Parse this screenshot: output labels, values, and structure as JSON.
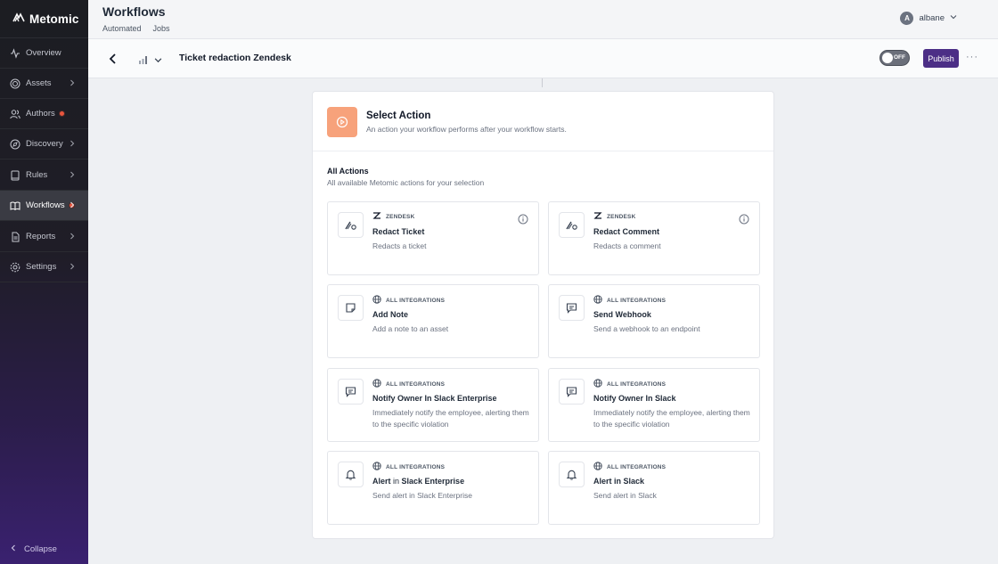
{
  "app": {
    "brand": "Metomic"
  },
  "sidebar": {
    "items": [
      {
        "label": "Overview",
        "icon": "activity-icon",
        "chevron": false,
        "badge": false
      },
      {
        "label": "Assets",
        "icon": "target-icon",
        "chevron": true,
        "badge": false
      },
      {
        "label": "Authors",
        "icon": "users-icon",
        "chevron": false,
        "badge": true
      },
      {
        "label": "Discovery",
        "icon": "compass-icon",
        "chevron": true,
        "badge": false
      },
      {
        "label": "Rules",
        "icon": "book-icon",
        "chevron": true,
        "badge": false
      },
      {
        "label": "Workflows",
        "icon": "open-book-icon",
        "chevron": true,
        "badge": true,
        "active": true
      },
      {
        "label": "Reports",
        "icon": "file-icon",
        "chevron": true,
        "badge": false
      },
      {
        "label": "Settings",
        "icon": "gear-icon",
        "chevron": true,
        "badge": false
      }
    ],
    "collapse_label": "Collapse"
  },
  "header": {
    "title": "Workflows",
    "tabs": [
      "Automated",
      "Jobs"
    ],
    "user": {
      "initial": "A",
      "name": "albane"
    }
  },
  "toolbar": {
    "workflow_title": "Ticket redaction Zendesk",
    "toggle_label": "OFF",
    "publish_label": "Publish",
    "more_label": "···"
  },
  "panel": {
    "title": "Select Action",
    "subtitle": "An action your workflow performs after your workflow starts.",
    "section_title": "All Actions",
    "section_subtitle": "All available Metomic actions for your selection",
    "cards": [
      {
        "integration": "ZENDESK",
        "title": "Redact Ticket",
        "desc": "Redacts a ticket",
        "icon": "redact-icon",
        "integ_icon": "zendesk-icon",
        "info": true
      },
      {
        "integration": "ZENDESK",
        "title": "Redact Comment",
        "desc": "Redacts a comment",
        "icon": "redact-icon",
        "integ_icon": "zendesk-icon",
        "info": true
      },
      {
        "integration": "ALL INTEGRATIONS",
        "title": "Add Note",
        "desc": "Add a note to an asset",
        "icon": "note-icon",
        "integ_icon": "globe-icon",
        "info": false
      },
      {
        "integration": "ALL INTEGRATIONS",
        "title": "Send Webhook",
        "desc": "Send a webhook to an endpoint",
        "icon": "message-icon",
        "integ_icon": "globe-icon",
        "info": false
      },
      {
        "integration": "ALL INTEGRATIONS",
        "title": "Notify Owner In Slack Enterprise",
        "desc": "Immediately notify the employee, alerting them to the specific violation",
        "icon": "message-icon",
        "integ_icon": "globe-icon",
        "info": false
      },
      {
        "integration": "ALL INTEGRATIONS",
        "title": "Notify Owner In Slack",
        "desc": "Immediately notify the employee, alerting them to the specific violation",
        "icon": "message-icon",
        "integ_icon": "globe-icon",
        "info": false
      },
      {
        "integration": "ALL INTEGRATIONS",
        "title_parts": [
          "Alert ",
          "in",
          " Slack Enterprise"
        ],
        "title": "Alert in Slack Enterprise",
        "desc": "Send alert in Slack Enterprise",
        "icon": "bell-icon",
        "integ_icon": "globe-icon",
        "info": false
      },
      {
        "integration": "ALL INTEGRATIONS",
        "title": "Alert in Slack",
        "desc": "Send alert in Slack",
        "icon": "bell-icon",
        "integ_icon": "globe-icon",
        "info": false
      }
    ]
  },
  "colors": {
    "accent": "#4c2e86",
    "action_icon_bg": "#f7a27b",
    "badge": "#e8553d"
  }
}
